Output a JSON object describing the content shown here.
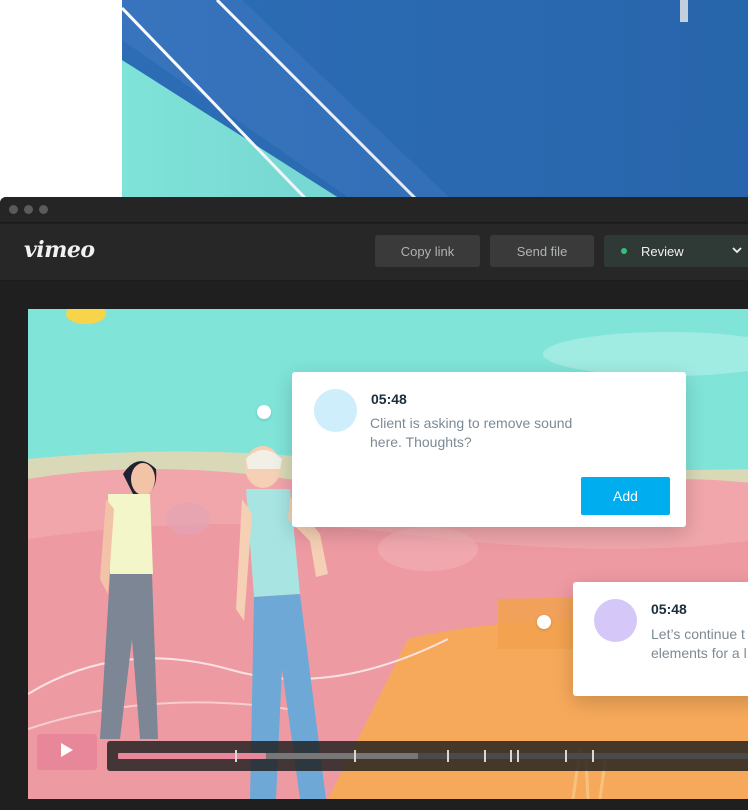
{
  "app": {
    "logo_text": "vimeo"
  },
  "toolbar": {
    "copy_link_label": "Copy link",
    "send_file_label": "Send file",
    "review_label": "Review",
    "review_status_color": "#2ec27e"
  },
  "comments": [
    {
      "timestamp": "05:48",
      "text_line1": "Client is asking to remove sound",
      "text_line2": "here. Thoughts?",
      "avatar_color": "#cdeefa",
      "add_label": "Add"
    },
    {
      "timestamp": "05:48",
      "text_line1": "Let’s continue t",
      "text_line2": "elements for a l",
      "avatar_color": "#d5c7f7"
    }
  ],
  "player": {
    "play_icon": "play-icon",
    "accent_color": "#e8879a"
  },
  "icons": {
    "window_controls": [
      "window-dot-icon",
      "window-dot-icon",
      "window-dot-icon"
    ],
    "review_dropdown": "chevron-down-icon",
    "status": "status-dot-icon"
  }
}
